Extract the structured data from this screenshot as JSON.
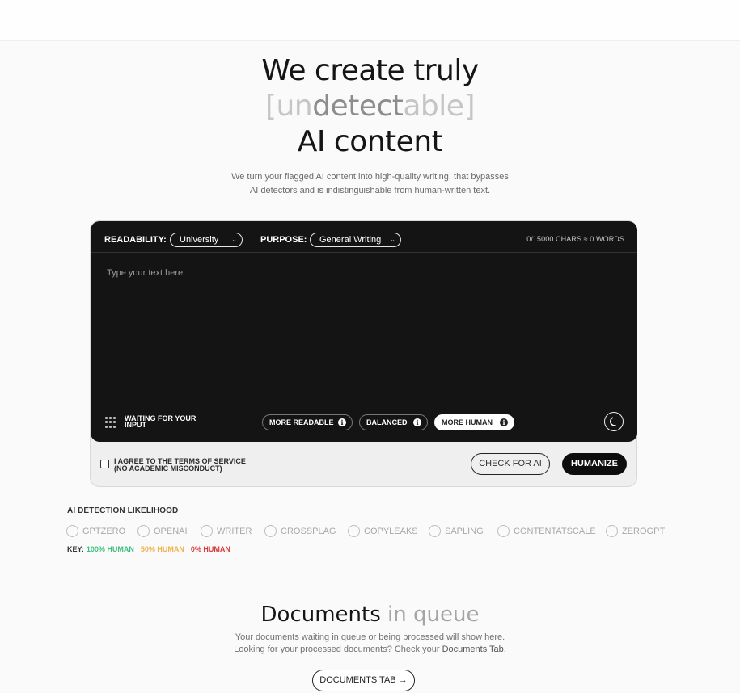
{
  "hero": {
    "line1": "We create truly",
    "line2_prefix": "[un",
    "line2_mid": "detect",
    "line2_suffix": "able]",
    "line3": "AI content"
  },
  "subtitle": {
    "line1": "We turn your flagged AI content into high-quality writing, that bypasses",
    "line2": "AI detectors and is indistinguishable from human-written text."
  },
  "editor": {
    "readability_label": "READABILITY:",
    "readability_value": "University",
    "purpose_label": "PURPOSE:",
    "purpose_value": "General Writing",
    "counter": "0/15000 CHARS ≈ 0 WORDS",
    "placeholder": "Type your text here",
    "status": "WAITING FOR YOUR INPUT",
    "modes": [
      {
        "label": "MORE READABLE",
        "active": false
      },
      {
        "label": "BALANCED",
        "active": false
      },
      {
        "label": "MORE HUMAN",
        "active": true
      }
    ],
    "theme_icon": "moon-icon"
  },
  "footer": {
    "agree_line1": "I AGREE TO THE TERMS OF SERVICE",
    "agree_line2": "(NO ACADEMIC MISCONDUCT)",
    "agree_checked": false,
    "check_button": "CHECK FOR AI",
    "humanize_button": "HUMANIZE"
  },
  "detection": {
    "title": "AI DETECTION LIKELIHOOD",
    "detectors": [
      "GPTZERO",
      "OPENAI",
      "WRITER",
      "CROSSPLAG",
      "COPYLEAKS",
      "SAPLING",
      "CONTENTATSCALE",
      "ZEROGPT"
    ],
    "key_label": "KEY:",
    "key": [
      {
        "label": "100% HUMAN",
        "color": "#3cbf7e"
      },
      {
        "label": "50% HUMAN",
        "color": "#f0b04a"
      },
      {
        "label": "0% HUMAN",
        "color": "#d93a3a"
      }
    ]
  },
  "documents": {
    "title_dark": "Documents",
    "title_grey": "in queue",
    "line1": "Your documents waiting in queue or being processed will show here.",
    "line2_prefix": "Looking for your processed documents? Check your ",
    "line2_link": "Documents Tab",
    "line2_suffix": ".",
    "button": "DOCUMENTS TAB →"
  }
}
